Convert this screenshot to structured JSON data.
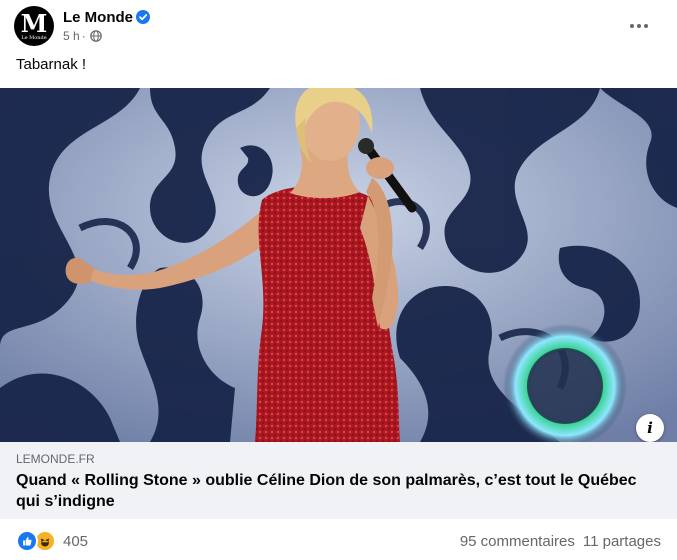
{
  "page": {
    "name": "Le Monde",
    "avatar_letter": "M",
    "avatar_small": "Le Monde",
    "time": "5 h",
    "dot": "·"
  },
  "post": {
    "text": "Tabarnak !"
  },
  "link": {
    "domain": "LEMONDE.FR",
    "title": "Quand « Rolling Stone » oublie Céline Dion de son palmarès, c’est tout le Québec qui s’indigne",
    "info_icon": "i"
  },
  "engagement": {
    "reaction_count": "405",
    "comments": "95 commentaires",
    "shares": "11 partages"
  },
  "icons": {
    "verified": "verified-badge-icon",
    "globe": "globe-icon",
    "more": "more-options-icon",
    "like": "like-reaction-icon",
    "haha": "haha-reaction-icon"
  },
  "colors": {
    "brand_blue": "#1877f2",
    "secondary_text": "#65676b",
    "link_bg": "#f0f2f5",
    "dress_red": "#b3202a"
  }
}
